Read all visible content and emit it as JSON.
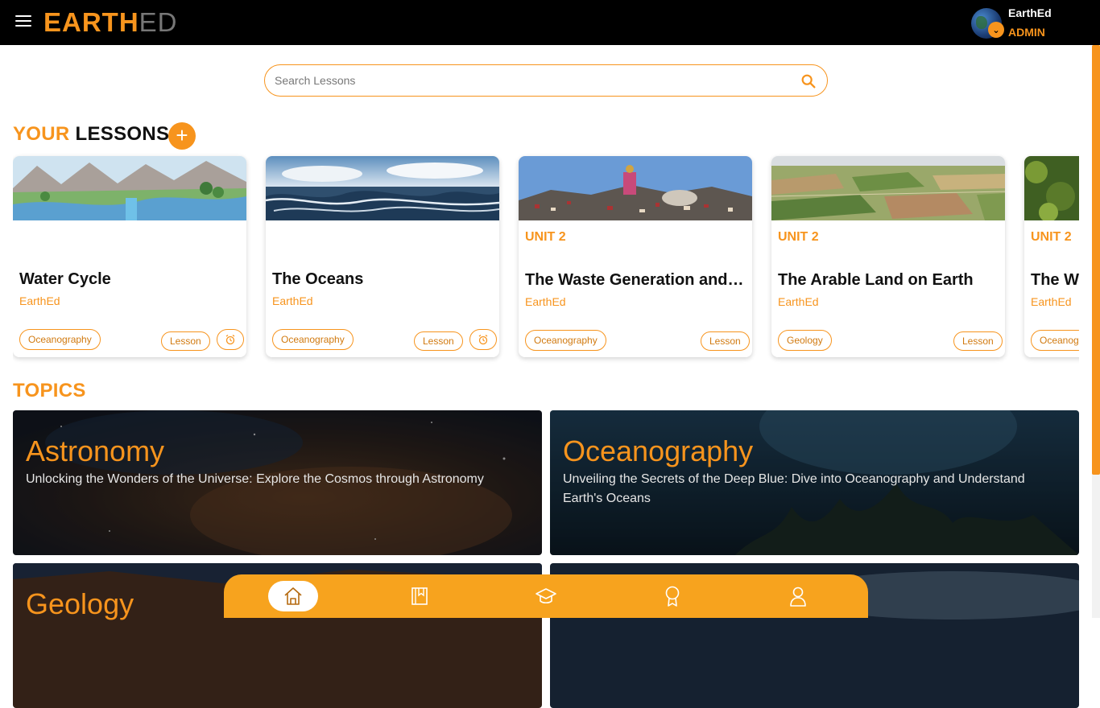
{
  "header": {
    "logo_primary": "EARTH",
    "logo_secondary": "ED",
    "user_name": "EarthEd",
    "user_role": "ADMIN"
  },
  "search": {
    "placeholder": "Search Lessons"
  },
  "lessons": {
    "title_primary": "YOUR",
    "title_secondary": "LESSONS",
    "add_label": "+",
    "cards": [
      {
        "unit": "",
        "title": "Water Cycle",
        "author": "EarthEd",
        "tag": "Oceanography",
        "type": "Lesson",
        "has_alarm": true
      },
      {
        "unit": "",
        "title": "The Oceans",
        "author": "EarthEd",
        "tag": "Oceanography",
        "type": "Lesson",
        "has_alarm": true
      },
      {
        "unit": "UNIT 2",
        "title": "The Waste Generation and Disposal",
        "author": "EarthEd",
        "tag": "Oceanography",
        "type": "Lesson",
        "has_alarm": false
      },
      {
        "unit": "UNIT 2",
        "title": "The Arable Land on Earth",
        "author": "EarthEd",
        "tag": "Geology",
        "type": "Lesson",
        "has_alarm": false
      },
      {
        "unit": "UNIT 2",
        "title": "The W",
        "author": "EarthEd",
        "tag": "Oceanog",
        "type": "",
        "has_alarm": false
      }
    ]
  },
  "topics": {
    "title": "TOPICS",
    "items": [
      {
        "name": "Astronomy",
        "description": "Unlocking the Wonders of the Universe: Explore the Cosmos through Astronomy"
      },
      {
        "name": "Oceanography",
        "description": "Unveiling the Secrets of the Deep Blue: Dive into Oceanography and Understand Earth's Oceans"
      },
      {
        "name": "Geology",
        "description": ""
      },
      {
        "name": "",
        "description": ""
      }
    ]
  },
  "nav": {
    "items": [
      {
        "icon": "home-icon",
        "active": true
      },
      {
        "icon": "book-icon",
        "active": false
      },
      {
        "icon": "graduation-cap-icon",
        "active": false
      },
      {
        "icon": "award-icon",
        "active": false
      },
      {
        "icon": "user-icon",
        "active": false
      }
    ]
  },
  "colors": {
    "accent": "#f7941d",
    "nav": "#f7a31e",
    "topbar": "#000000"
  }
}
